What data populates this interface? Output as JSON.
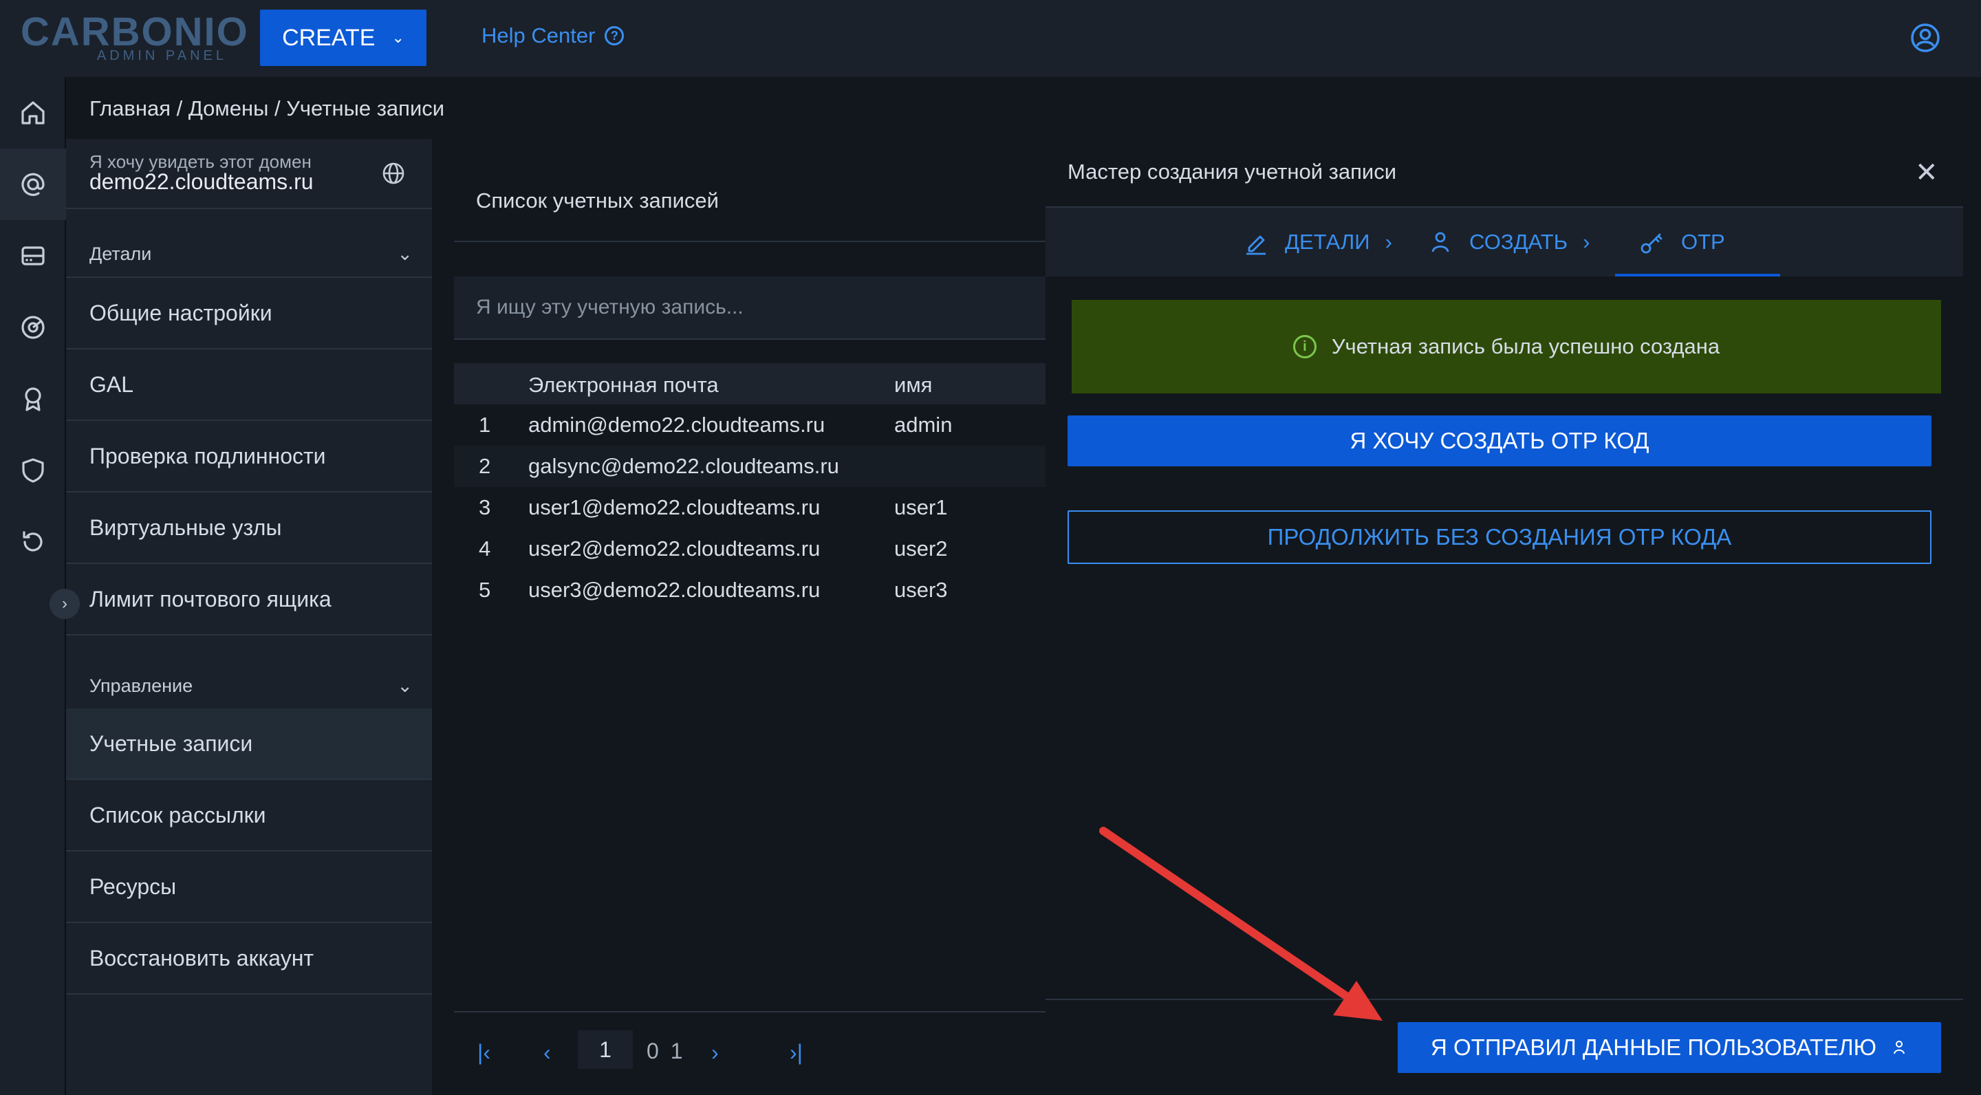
{
  "topbar": {
    "logo_main": "CARBONIO",
    "logo_sub": "ADMIN PANEL",
    "create_label": "CREATE",
    "help_label": "Help Center"
  },
  "breadcrumb": "Главная / Домены / Учетные записи",
  "sidenav": {
    "domain_label": "Я хочу увидеть этот домен",
    "domain_value": "demo22.cloudteams.ru",
    "section_details": "Детали",
    "details_items": [
      "Общие настройки",
      "GAL",
      "Проверка подлинности",
      "Виртуальные узлы",
      "Лимит почтового ящика"
    ],
    "section_manage": "Управление",
    "manage_items": [
      "Учетные записи",
      "Список рассылки",
      "Ресурсы",
      "Восстановить аккаунт"
    ]
  },
  "list": {
    "title": "Список учетных записей",
    "search_placeholder": "Я ищу эту учетную запись...",
    "col_email": "Электронная почта",
    "col_name": "имя",
    "rows": [
      {
        "n": "1",
        "email": "admin@demo22.cloudteams.ru",
        "name": "admin"
      },
      {
        "n": "2",
        "email": "galsync@demo22.cloudteams.ru",
        "name": ""
      },
      {
        "n": "3",
        "email": "user1@demo22.cloudteams.ru",
        "name": "user1"
      },
      {
        "n": "4",
        "email": "user2@demo22.cloudteams.ru",
        "name": "user2"
      },
      {
        "n": "5",
        "email": "user3@demo22.cloudteams.ru",
        "name": "user3"
      }
    ],
    "page_current": "1",
    "page_total": "0 1"
  },
  "wizard": {
    "title": "Мастер создания учетной записи",
    "step_details": "ДЕТАЛИ",
    "step_create": "СОЗДАТЬ",
    "step_otp": "OTP",
    "success_message": "Учетная запись была успешно создана",
    "btn_create_otp": "Я ХОЧУ СОЗДАТЬ OTP КОД",
    "btn_skip_otp": "ПРОДОЛЖИТЬ БЕЗ СОЗДАНИЯ OTP КОДА",
    "btn_finish": "Я ОТПРАВИЛ ДАННЫЕ ПОЛЬЗОВАТЕЛЮ"
  },
  "colors": {
    "accent": "#0c5ad6",
    "link": "#3a8ff0",
    "success_bg": "#2e4a0a",
    "annotation_arrow": "#e53935"
  }
}
